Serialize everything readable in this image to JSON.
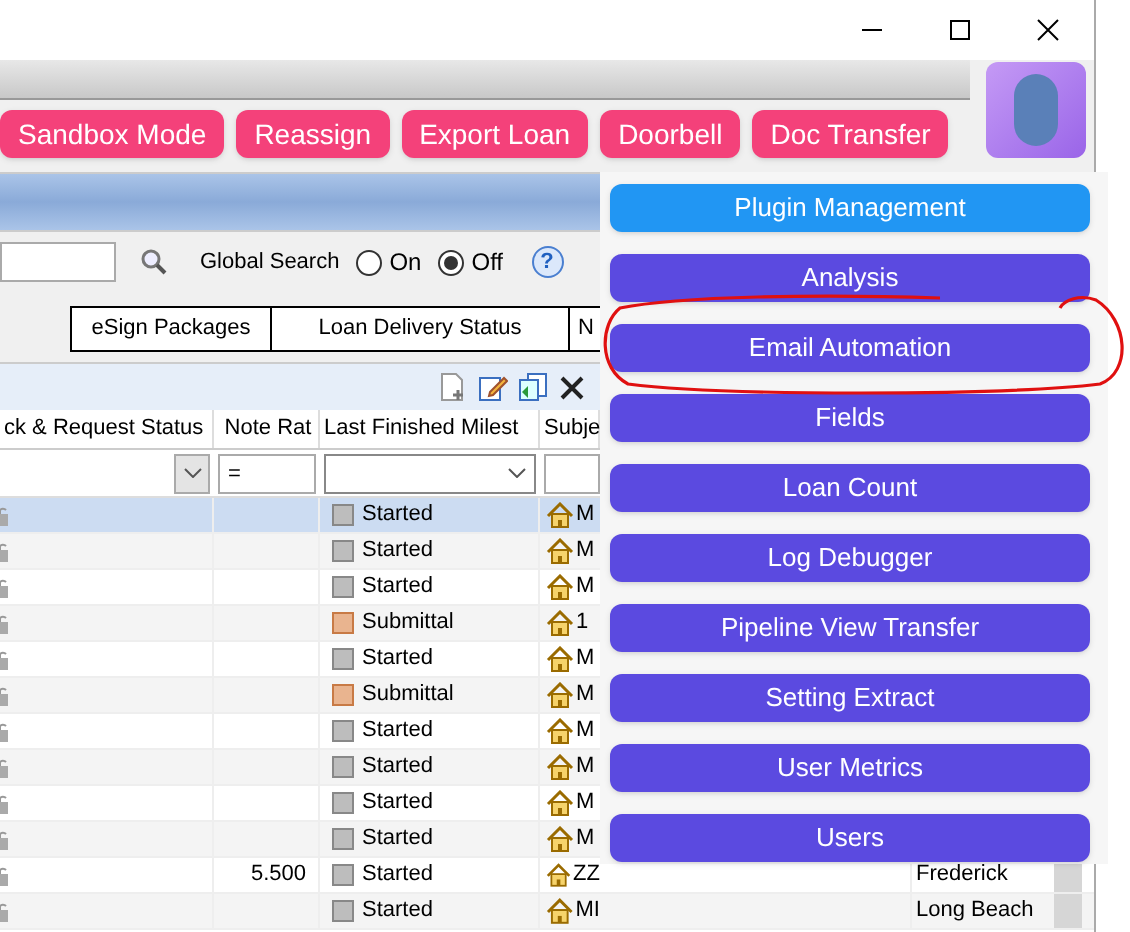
{
  "toolbar_buttons": [
    "Sandbox Mode",
    "Reassign",
    "Export Loan",
    "Doorbell",
    "Doc Transfer"
  ],
  "search": {
    "label": "Global Search",
    "help": "?",
    "options": [
      {
        "label": "On",
        "selected": false
      },
      {
        "label": "Off",
        "selected": true
      }
    ]
  },
  "tabs": [
    {
      "label": "eSign Packages",
      "selected": false
    },
    {
      "label": "Loan Delivery Status",
      "selected": false
    },
    {
      "label": "N",
      "selected": false
    }
  ],
  "table": {
    "columns": [
      "ck & Request Status",
      "Note Rat",
      "Last Finished Milest",
      "Subje"
    ],
    "filters": {
      "column_2": "="
    },
    "rows": [
      {
        "selected": true,
        "note_rate": "",
        "milestone": "Started",
        "kind": "started",
        "subject": "M",
        "column_6": ""
      },
      {
        "selected": false,
        "note_rate": "",
        "milestone": "Started",
        "kind": "started",
        "subject": "M",
        "column_6": ""
      },
      {
        "selected": false,
        "note_rate": "",
        "milestone": "Started",
        "kind": "started",
        "subject": "M",
        "column_6": ""
      },
      {
        "selected": false,
        "note_rate": "",
        "milestone": "Submittal",
        "kind": "submittal",
        "subject": "1",
        "column_6": ""
      },
      {
        "selected": false,
        "note_rate": "",
        "milestone": "Started",
        "kind": "started",
        "subject": "M",
        "column_6": ""
      },
      {
        "selected": false,
        "note_rate": "",
        "milestone": "Submittal",
        "kind": "submittal",
        "subject": "M",
        "column_6": ""
      },
      {
        "selected": false,
        "note_rate": "",
        "milestone": "Started",
        "kind": "started",
        "subject": "M",
        "column_6": ""
      },
      {
        "selected": false,
        "note_rate": "",
        "milestone": "Started",
        "kind": "started",
        "subject": "M",
        "column_6": ""
      },
      {
        "selected": false,
        "note_rate": "",
        "milestone": "Started",
        "kind": "started",
        "subject": "M",
        "column_6": ""
      },
      {
        "selected": false,
        "note_rate": "",
        "milestone": "Started",
        "kind": "started",
        "subject": "M",
        "column_6": ""
      },
      {
        "selected": false,
        "note_rate": "5.500",
        "milestone": "Started",
        "kind": "started",
        "subject": "ZZ",
        "column_6": "Frederick"
      },
      {
        "selected": false,
        "note_rate": "",
        "milestone": "Started",
        "kind": "started",
        "subject": "MI",
        "column_6": "Long Beach"
      }
    ]
  },
  "plugin_menu": [
    {
      "label": "Plugin Management",
      "kind": "primary"
    },
    {
      "label": "Analysis",
      "kind": "plugin"
    },
    {
      "label": "Email Automation",
      "kind": "plugin",
      "circled": true
    },
    {
      "label": "Fields",
      "kind": "plugin"
    },
    {
      "label": "Loan Count",
      "kind": "plugin"
    },
    {
      "label": "Log Debugger",
      "kind": "plugin"
    },
    {
      "label": "Pipeline View Transfer",
      "kind": "plugin"
    },
    {
      "label": "Setting Extract",
      "kind": "plugin"
    },
    {
      "label": "User Metrics",
      "kind": "plugin"
    },
    {
      "label": "Users",
      "kind": "plugin"
    }
  ]
}
